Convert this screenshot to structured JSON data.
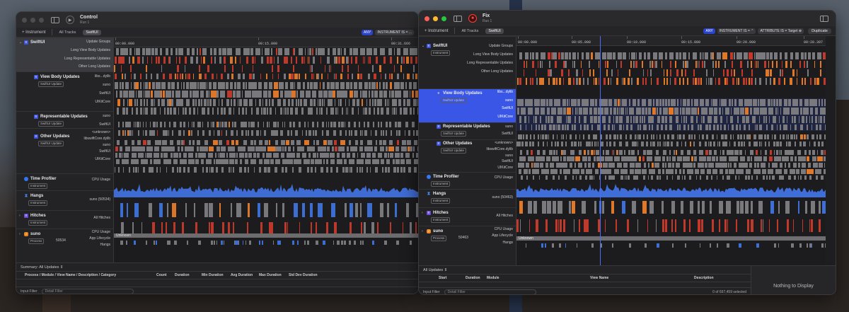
{
  "windows": {
    "control": {
      "title": "Control",
      "run": "Run 1",
      "instrument_button": "+ Instrument",
      "tab_all_tracks": "All Tracks",
      "tab_swiftui": "SwiftUI",
      "filter_pills": [
        "ANY",
        "INSTRUMENT IS = ..."
      ],
      "ruler_ticks": [
        "00:00.000",
        "00:15.000",
        "00:31.666"
      ],
      "tracks": {
        "swiftui": {
          "name": "SwiftUI",
          "rows": [
            "Update Groups",
            "Long View Body Updates",
            "Long Representable Updates",
            "Other Long Updates"
          ]
        },
        "view_body": {
          "name": "View Body Updates",
          "badge": "SwiftUI Update",
          "rows": [
            "libs...dylib",
            "suno",
            "SwiftUI",
            "UIKitCore"
          ]
        },
        "representable": {
          "name": "Representable Updates",
          "badge": "SwiftUI Update",
          "rows": [
            "suno",
            "SwiftUI"
          ]
        },
        "other": {
          "name": "Other Updates",
          "badge": "SwiftUI Update",
          "rows": [
            "<unknown>",
            "libswiftCore.dylib",
            "suno",
            "SwiftUI",
            "UIKitCore"
          ]
        },
        "time_profiler": {
          "name": "Time Profiler",
          "badge": "Instrument",
          "rows": [
            "CPU Usage"
          ]
        },
        "hangs": {
          "name": "Hangs",
          "badge": "Instrument",
          "rows": [
            "suno (50534)"
          ]
        },
        "hitches": {
          "name": "Hitches",
          "badge": "Instrument",
          "rows": [
            "All Hitches"
          ]
        },
        "suno": {
          "name": "suno",
          "badge": "Process",
          "pid": "50534",
          "rows": [
            "CPU Usage",
            "App Lifecycle",
            "Hangs"
          ],
          "lifecycle_label": "Unknown"
        }
      },
      "summary_label": "Summary: All Updates ⇕",
      "columns": [
        "Process / Module / View Name / Description / Category",
        "Count",
        "Duration",
        "Min Duration",
        "Avg Duration",
        "Max Duration",
        "Std Dev Duration"
      ],
      "input_filter_label": "Input Filter",
      "detail_filter_placeholder": "Detail Filter"
    },
    "fix": {
      "title": "Fix",
      "run": "Run 1",
      "instrument_button": "+ Instrument",
      "tab_all_tracks": "All Tracks",
      "tab_swiftui": "SwiftUI",
      "filter_pills": [
        "ANY",
        "INSTRUMENT IS = ⌃",
        "ATTRIBUTE IS = Target ⊕"
      ],
      "duplicate_button": "Duplicate",
      "ruler_ticks": [
        "00:00.000",
        "00:05.000",
        "00:10.000",
        "00:15.000",
        "00:20.000",
        "00:28.397"
      ],
      "tracks": {
        "swiftui": {
          "name": "SwiftUI",
          "badge": "Instrument",
          "rows": [
            "Update Groups",
            "Long View Body Updates",
            "Long Representable Updates",
            "Other Long Updates"
          ]
        },
        "view_body": {
          "name": "View Body Updates",
          "badge": "SwiftUI Update",
          "rows": [
            "libs...dylib",
            "suno",
            "SwiftUI",
            "UIKitCore"
          ]
        },
        "representable": {
          "name": "Representable Updates",
          "badge": "SwiftUI Update",
          "rows": [
            "suno",
            "SwiftUI"
          ]
        },
        "other": {
          "name": "Other Updates",
          "badge": "SwiftUI Update",
          "rows": [
            "<unknown>",
            "libswiftCore.dylib",
            "suno",
            "SwiftUI",
            "UIKitCore"
          ]
        },
        "time_profiler": {
          "name": "Time Profiler",
          "badge": "Instrument",
          "rows": [
            "CPU Usage"
          ]
        },
        "hangs": {
          "name": "Hangs",
          "badge": "Instrument",
          "rows": [
            "suno (50463)"
          ]
        },
        "hitches": {
          "name": "Hitches",
          "badge": "Instrument",
          "rows": [
            "All Hitches"
          ]
        },
        "suno": {
          "name": "suno",
          "badge": "Process",
          "pid": "50463",
          "rows": [
            "CPU Usage",
            "App Lifecycle",
            "Hangs"
          ],
          "lifecycle_label": "Unknown"
        }
      },
      "summary_label": "All Updates ⇕",
      "columns": [
        "Start",
        "Duration",
        "Module",
        "View Name",
        "Description"
      ],
      "input_filter_label": "Input Filter",
      "detail_filter_placeholder": "Detail Filter",
      "selection_status": "0 of 697,459 selected",
      "nothing_to_display": "Nothing to Display"
    }
  },
  "colors": {
    "selection": "#3a56e6",
    "grey_bar": "#7a7a7e",
    "orange_bar": "#e0782a",
    "red_bar": "#c0392b",
    "blue_bar": "#3d6fd6",
    "cpu": "#3f6ed8"
  }
}
